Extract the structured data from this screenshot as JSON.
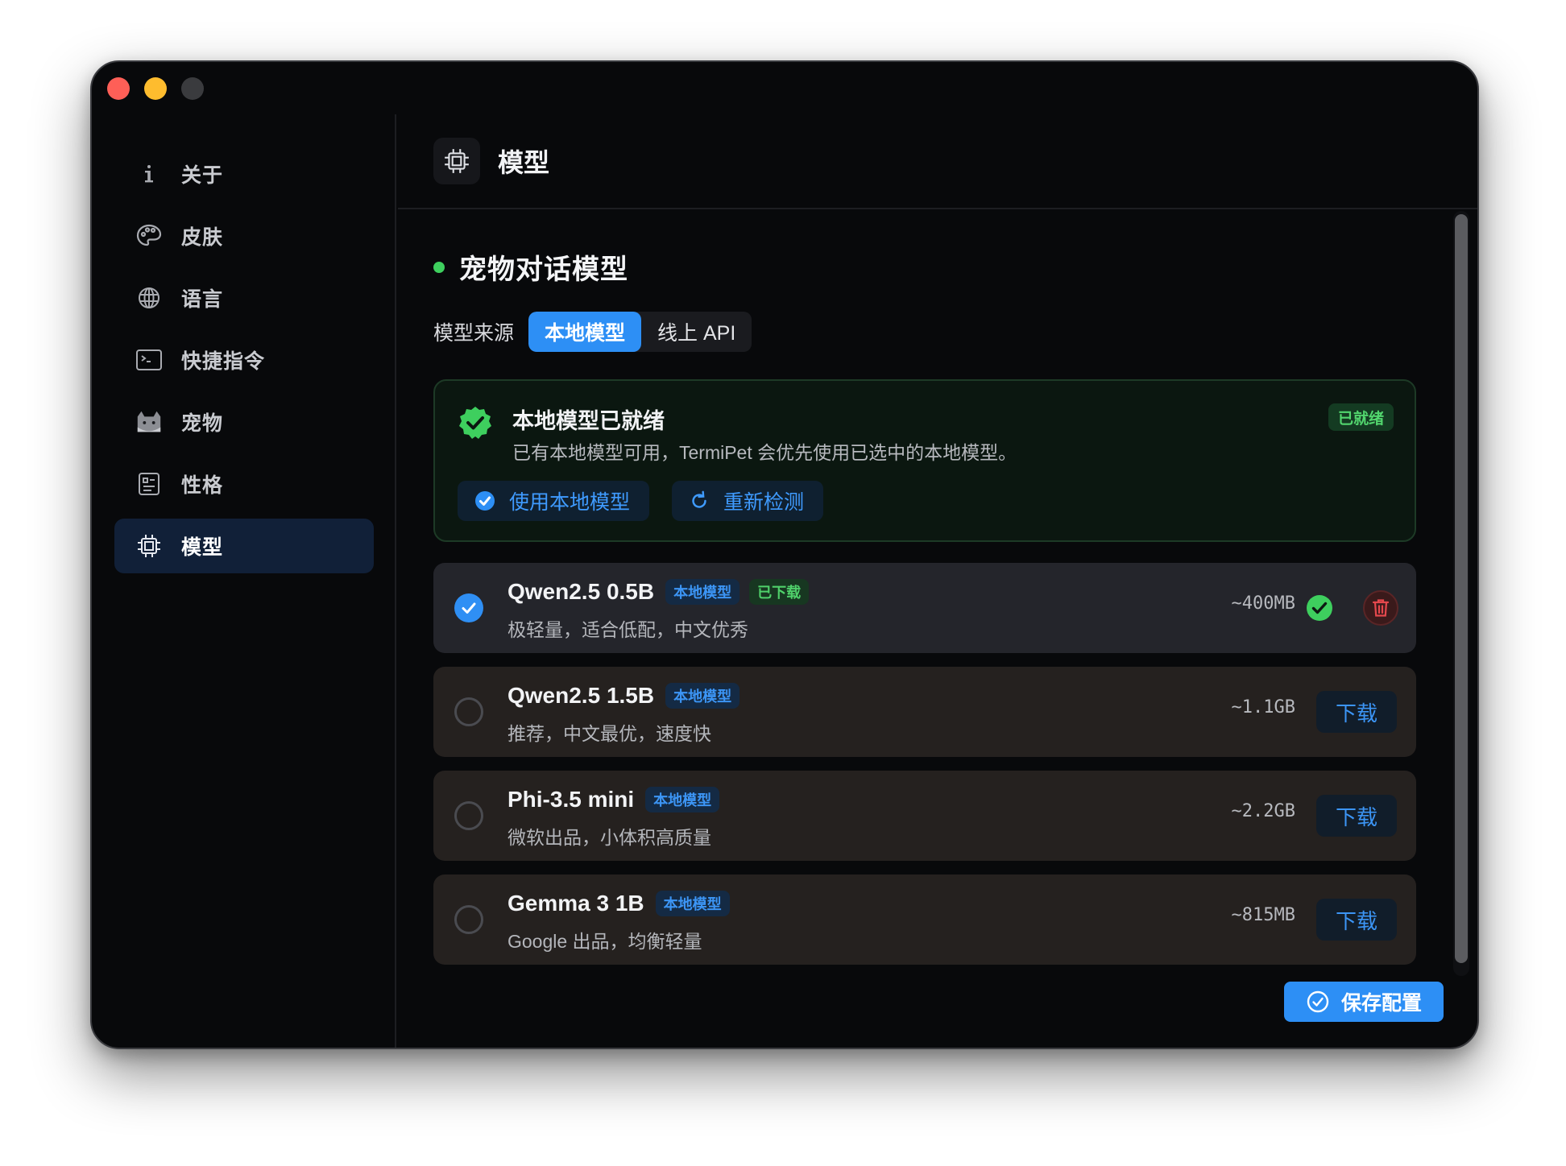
{
  "window": {
    "traffic_lights": [
      "close",
      "minimize",
      "zoom"
    ]
  },
  "sidebar": {
    "items": [
      {
        "label": "关于",
        "icon": "info-icon"
      },
      {
        "label": "皮肤",
        "icon": "palette-icon"
      },
      {
        "label": "语言",
        "icon": "globe-icon"
      },
      {
        "label": "快捷指令",
        "icon": "terminal-icon"
      },
      {
        "label": "宠物",
        "icon": "cat-icon"
      },
      {
        "label": "性格",
        "icon": "profile-card-icon"
      },
      {
        "label": "模型",
        "icon": "chip-icon",
        "active": true
      }
    ]
  },
  "header": {
    "title": "模型",
    "icon": "chip-icon"
  },
  "section": {
    "title": "宠物对话模型",
    "status_color": "#3ecf5e"
  },
  "source": {
    "label": "模型来源",
    "options": [
      "本地模型",
      "线上 API"
    ],
    "selected": "本地模型"
  },
  "ready_card": {
    "title": "本地模型已就绪",
    "description": "已有本地模型可用，TermiPet 会优先使用已选中的本地模型。",
    "badge": "已就绪",
    "use_button": "使用本地模型",
    "recheck_button": "重新检测"
  },
  "models": [
    {
      "name": "Qwen2.5 0.5B",
      "tag": "本地模型",
      "downloaded_tag": "已下载",
      "desc": "极轻量，适合低配，中文优秀",
      "size": "~400MB",
      "selected": true
    },
    {
      "name": "Qwen2.5 1.5B",
      "tag": "本地模型",
      "desc": "推荐，中文最优，速度快",
      "size": "~1.1GB",
      "action": "下载"
    },
    {
      "name": "Phi-3.5 mini",
      "tag": "本地模型",
      "desc": "微软出品，小体积高质量",
      "size": "~2.2GB",
      "action": "下载"
    },
    {
      "name": "Gemma 3 1B",
      "tag": "本地模型",
      "desc": "Google 出品，均衡轻量",
      "size": "~815MB",
      "action": "下载"
    }
  ],
  "footer": {
    "save_label": "保存配置"
  },
  "colors": {
    "accent": "#2d8ff5",
    "success": "#3ecf5e",
    "danger": "#e5484d"
  }
}
